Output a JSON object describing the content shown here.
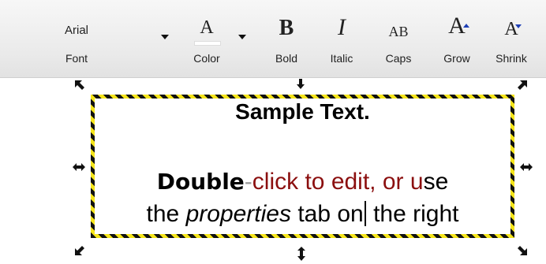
{
  "toolbar": {
    "font": {
      "value": "Arial",
      "label": "Font"
    },
    "color": {
      "glyph": "A",
      "label": "Color"
    },
    "bold": {
      "glyph": "B",
      "label": "Bold"
    },
    "italic": {
      "glyph": "I",
      "label": "Italic"
    },
    "caps": {
      "glyph": "AB",
      "label": "Caps"
    },
    "grow": {
      "glyph": "A",
      "label": "Grow"
    },
    "shrink": {
      "glyph": "A",
      "label": "Shrink"
    }
  },
  "canvas": {
    "title": "Sample Text.",
    "body_line1": {
      "part1": "Double",
      "part2": "-",
      "part3": "click to edit, or u",
      "part4": "se"
    },
    "body_line2": {
      "part1": "the ",
      "part2": "properties",
      "part3": " tab on",
      "part4": " the right"
    }
  },
  "colors": {
    "accent_red": "#8b0f0f",
    "selection_stripe_dark": "#111111",
    "selection_stripe_yellow": "#f5e51b",
    "grow_shrink_arrow": "#1e3fb5"
  },
  "icons": {
    "dropdown": "triangle-down",
    "resize_handles": [
      "nw-arrow",
      "n-arrow",
      "ne-arrow",
      "w-arrow",
      "e-arrow",
      "sw-arrow",
      "s-arrow",
      "se-arrow"
    ]
  }
}
